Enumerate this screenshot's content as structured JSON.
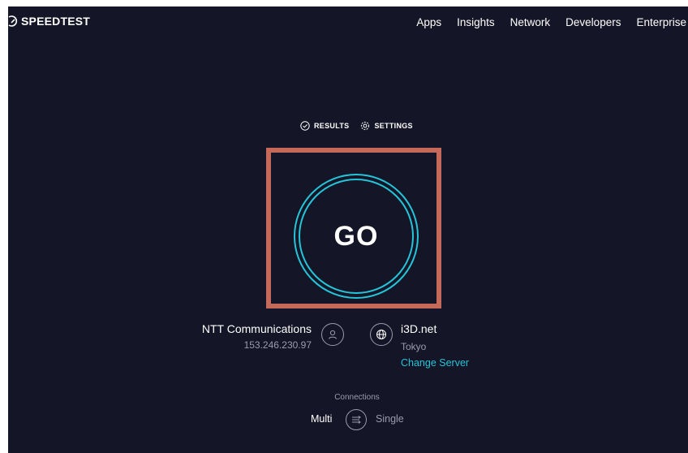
{
  "header": {
    "logo_text": "SPEEDTEST",
    "nav": [
      "Apps",
      "Insights",
      "Network",
      "Developers",
      "Enterprise"
    ]
  },
  "tabs": {
    "results": "RESULTS",
    "settings": "SETTINGS"
  },
  "go_button": {
    "label": "GO"
  },
  "isp": {
    "name": "NTT Communications",
    "ip": "153.246.230.97"
  },
  "server": {
    "name": "i3D.net",
    "city": "Tokyo",
    "change_label": "Change Server"
  },
  "connections": {
    "label": "Connections",
    "multi": "Multi",
    "single": "Single"
  },
  "colors": {
    "background": "#141526",
    "accent": "#25c4d8",
    "highlight": "#c56a5b",
    "muted": "#9a9cab"
  },
  "icons": [
    "speedtest-logo-icon",
    "check-circle-icon",
    "gear-icon",
    "user-icon",
    "globe-icon",
    "connections-icon"
  ]
}
